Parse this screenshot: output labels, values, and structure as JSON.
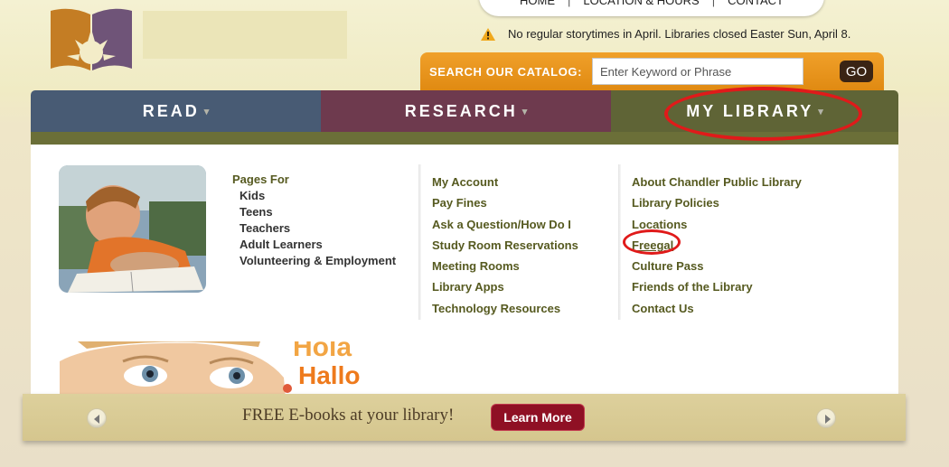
{
  "top_nav": {
    "items": [
      "HOME",
      "LOCATION & HOURS",
      "CONTACT"
    ],
    "separator": "|"
  },
  "alert": {
    "icon": "warning-icon",
    "text": "No regular storytimes in April. Libraries closed Easter Sun, April 8."
  },
  "search": {
    "label": "SEARCH OUR CATALOG:",
    "placeholder": "Enter Keyword or Phrase",
    "value": "",
    "button": "GO"
  },
  "main_nav": {
    "tabs": [
      {
        "label": "READ",
        "color": "#485b74"
      },
      {
        "label": "RESEARCH",
        "color": "#6e3a4e"
      },
      {
        "label": "MY LIBRARY",
        "color": "#5f6436"
      }
    ],
    "caret": "▾"
  },
  "dropdown": {
    "pages_for": {
      "heading": "Pages For",
      "items": [
        "Kids",
        "Teens",
        "Teachers",
        "Adult Learners",
        "Volunteering & Employment"
      ]
    },
    "col2": [
      "My Account",
      "Pay Fines",
      "Ask a Question/How Do I",
      "Study Room Reservations",
      "Meeting Rooms",
      "Library Apps",
      "Technology Resources"
    ],
    "col3": [
      "About Chandler Public Library",
      "Library Policies",
      "Locations",
      "Freegal",
      "Culture Pass",
      "Friends of the Library",
      "Contact Us"
    ]
  },
  "promo": {
    "line1": "Hola",
    "line2": "Hallo"
  },
  "banner": {
    "text": "FREE E-books at your library!",
    "button": "Learn More"
  },
  "colors": {
    "accent_orange": "#e8961e",
    "link_olive": "#565a20",
    "highlight_red": "#e01a1a",
    "learn_more": "#8f1024"
  }
}
